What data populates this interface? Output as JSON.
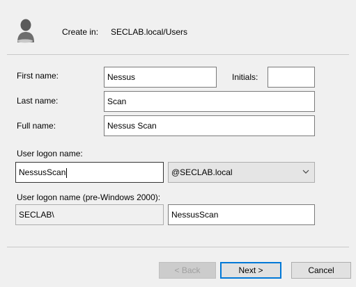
{
  "header": {
    "create_in_label": "Create in:",
    "create_in_path": "SECLAB.local/Users",
    "icon": "user-icon"
  },
  "form": {
    "first_name_label": "First name:",
    "first_name_value": "Nessus",
    "initials_label": "Initials:",
    "initials_value": "",
    "last_name_label": "Last name:",
    "last_name_value": "Scan",
    "full_name_label": "Full name:",
    "full_name_value": "Nessus Scan",
    "logon_label": "User logon name:",
    "logon_value": "NessusScan",
    "domain_selected": "@SECLAB.local",
    "pre2000_label": "User logon name (pre-Windows 2000):",
    "pre2000_domain": "SECLAB\\",
    "pre2000_value": "NessusScan"
  },
  "buttons": {
    "back": "< Back",
    "next": "Next >",
    "cancel": "Cancel"
  },
  "colors": {
    "accent": "#0078d7",
    "background": "#f0f0f0"
  }
}
